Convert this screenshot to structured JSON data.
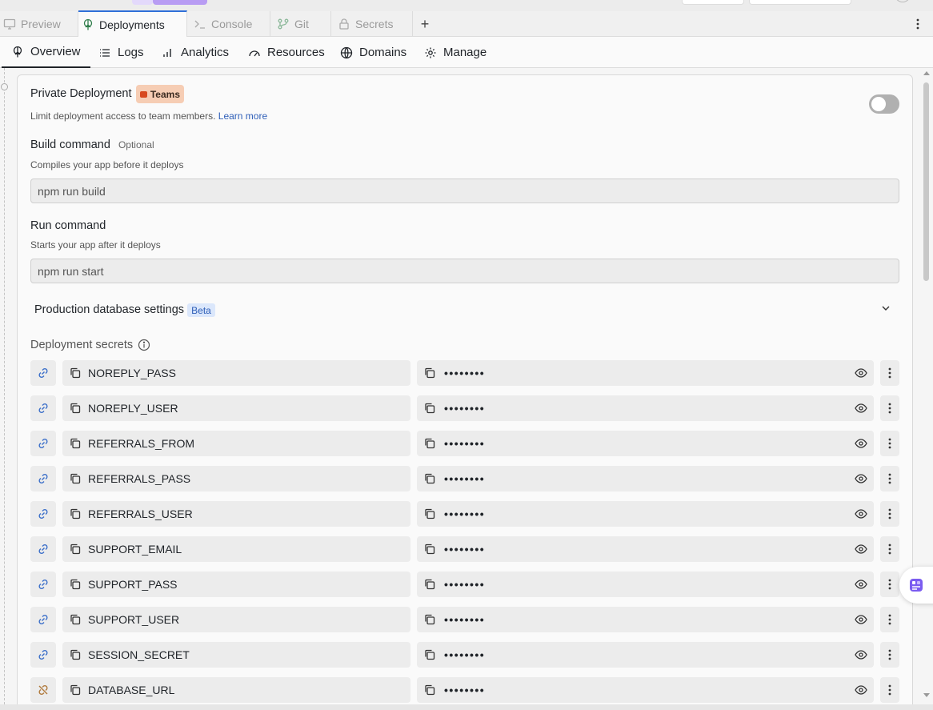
{
  "tabs": [
    {
      "label": "Preview",
      "active": false,
      "icon": "monitor-icon"
    },
    {
      "label": "Deployments",
      "active": true,
      "icon": "deployments-icon"
    },
    {
      "label": "Console",
      "active": false,
      "icon": "terminal-icon"
    },
    {
      "label": "Git",
      "active": false,
      "icon": "git-icon"
    },
    {
      "label": "Secrets",
      "active": false,
      "icon": "lock-icon"
    }
  ],
  "tab_add_label": "+",
  "subnav": [
    {
      "label": "Overview",
      "active": true,
      "icon": "deployments-icon"
    },
    {
      "label": "Logs",
      "active": false,
      "icon": "list-icon"
    },
    {
      "label": "Analytics",
      "active": false,
      "icon": "bar-chart-icon"
    },
    {
      "label": "Resources",
      "active": false,
      "icon": "gauge-icon"
    },
    {
      "label": "Domains",
      "active": false,
      "icon": "globe-icon"
    },
    {
      "label": "Manage",
      "active": false,
      "icon": "gear-icon"
    }
  ],
  "private": {
    "title": "Private Deployment",
    "badge": "Teams",
    "description": "Limit deployment access to team members.",
    "learn_more": "Learn more",
    "enabled": false
  },
  "build": {
    "title": "Build command",
    "optional": "Optional",
    "description": "Compiles your app before it deploys",
    "value": "npm run build"
  },
  "run": {
    "title": "Run command",
    "description": "Starts your app after it deploys",
    "value": "npm run start"
  },
  "db": {
    "title": "Production database settings",
    "badge": "Beta"
  },
  "secrets": {
    "title": "Deployment secrets",
    "masked": "••••••••",
    "rows": [
      {
        "key": "NOREPLY_PASS",
        "linked": true
      },
      {
        "key": "NOREPLY_USER",
        "linked": true
      },
      {
        "key": "REFERRALS_FROM",
        "linked": true
      },
      {
        "key": "REFERRALS_PASS",
        "linked": true
      },
      {
        "key": "REFERRALS_USER",
        "linked": true
      },
      {
        "key": "SUPPORT_EMAIL",
        "linked": true
      },
      {
        "key": "SUPPORT_PASS",
        "linked": true
      },
      {
        "key": "SUPPORT_USER",
        "linked": true
      },
      {
        "key": "SESSION_SECRET",
        "linked": true
      },
      {
        "key": "DATABASE_URL",
        "linked": false
      }
    ]
  },
  "colors": {
    "accent": "#2f6fd8",
    "link": "#2f5fb8",
    "teams_badge": "#f6cdb4",
    "beta_badge": "#dbe7fb",
    "unlinked_icon": "#b07a3c"
  }
}
